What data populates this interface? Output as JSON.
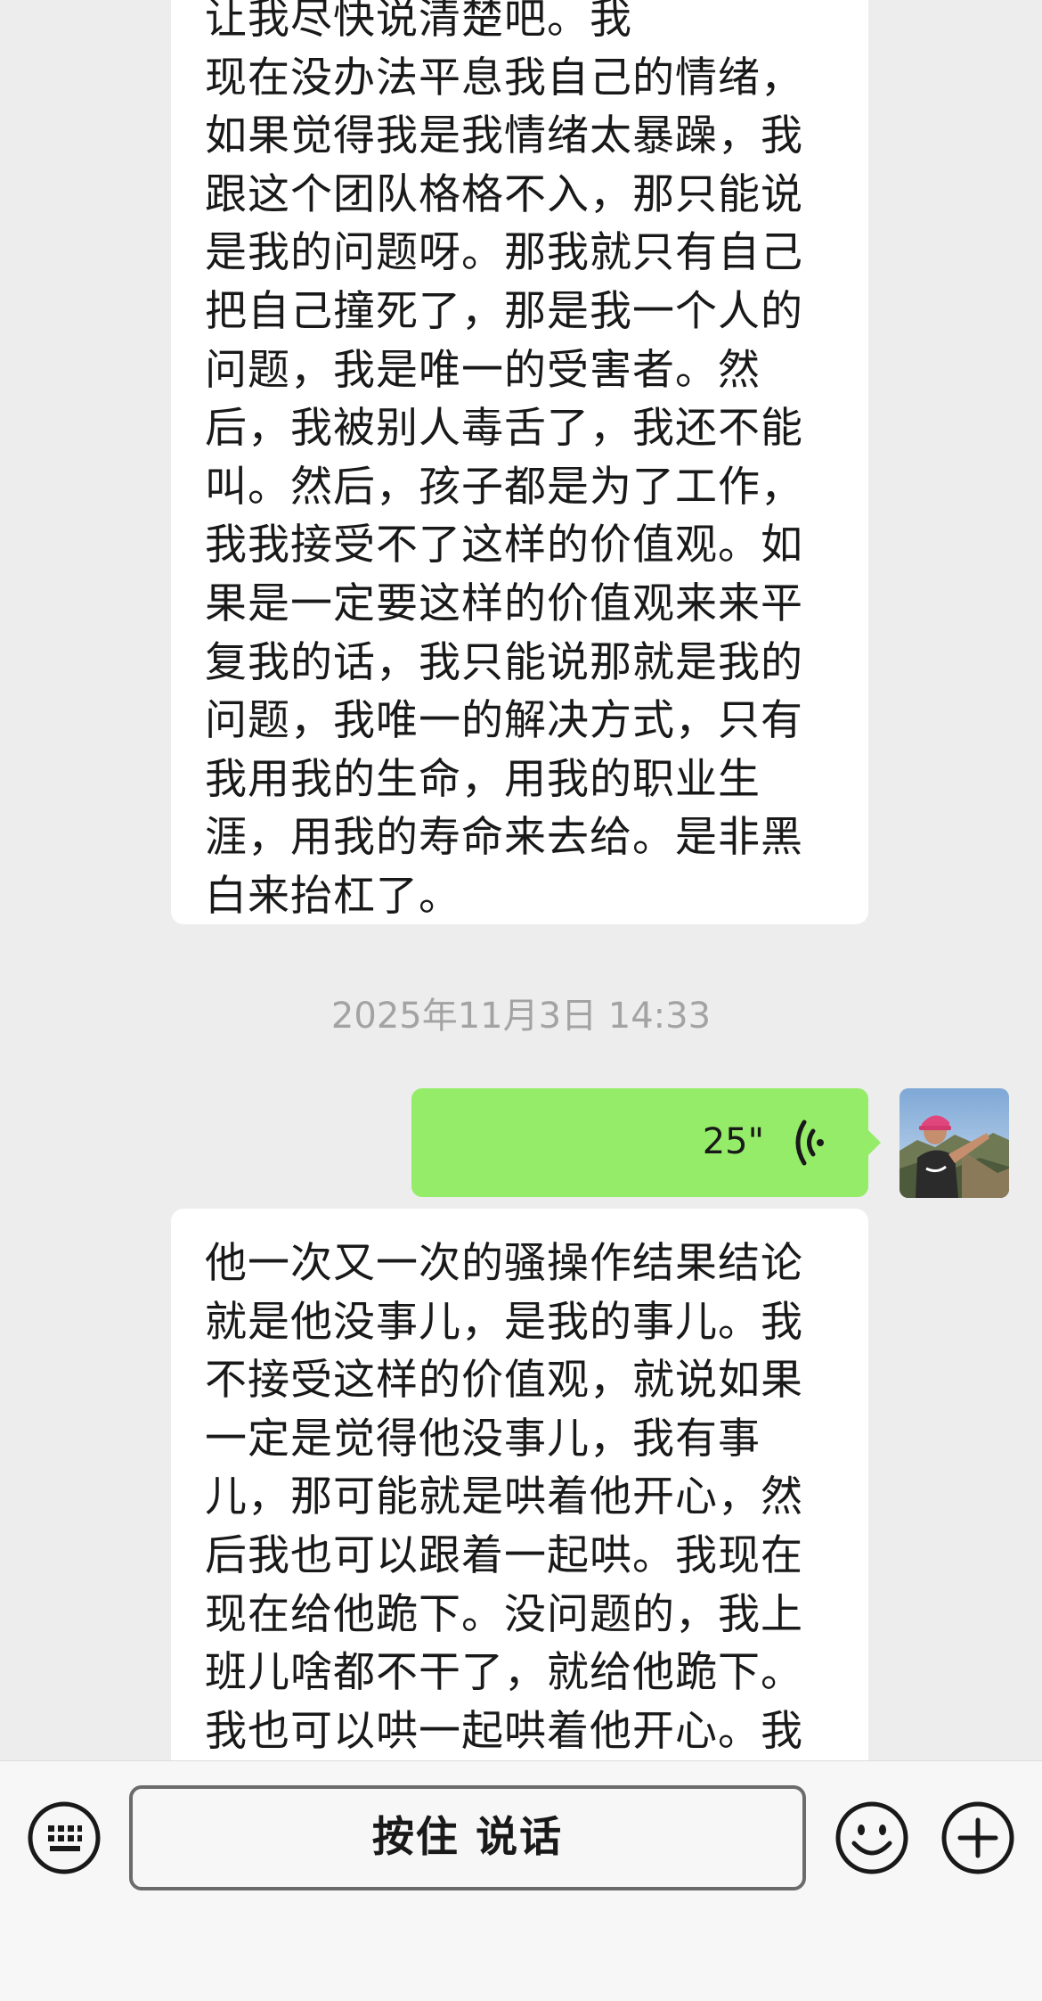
{
  "messages": {
    "incoming_1": {
      "text": "让我尽快说清楚吧。我\n现在没办法平息我自己的情绪，\n如果觉得我是我情绪太暴躁，我\n跟这个团队格格不入，那只能说\n是我的问题呀。那我就只有自己\n把自己撞死了，那是我一个人的\n问题，我是唯一的受害者。然\n后，我被别人毒舌了，我还不能\n叫。然后，孩子都是为了工作，\n我我接受不了这样的价值观。如\n果是一定要这样的价值观来来平\n复我的话，我只能说那就是我的\n问题，我唯一的解决方式，只有\n我用我的生命，用我的职业生\n涯，用我的寿命来去给。是非黑\n白来抬杠了。"
    },
    "timestamp": "2025年11月3日 14:33",
    "voice": {
      "duration": "25\""
    },
    "incoming_2": {
      "text": "他一次又一次的骚操作结果结论\n就是他没事儿，是我的事儿。我\n不接受这样的价值观，就说如果\n一定是觉得他没事儿，我有事\n儿，那可能就是哄着他开心，然\n后我也可以跟着一起哄。我现在\n现在给他跪下。没问题的，我上\n班儿啥都不干了，就给他跪下。\n我也可以哄一起哄着他开心。我"
    }
  },
  "input_bar": {
    "hold_to_talk_label": "按住 说话"
  },
  "icons": {
    "keyboard": "keyboard-icon",
    "emoji": "emoji-icon",
    "plus": "plus-icon",
    "voice": "voice-wave-icon"
  },
  "colors": {
    "background": "#ededed",
    "incoming_bubble": "#ffffff",
    "outgoing_bubble": "#95ec69",
    "timestamp_text": "#a3a3a3",
    "input_bar": "#f7f7f7"
  }
}
